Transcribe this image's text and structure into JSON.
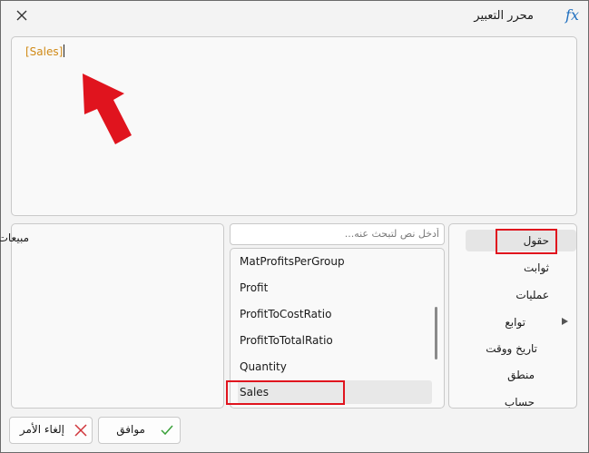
{
  "dialog": {
    "title": "محرر التعبير",
    "fx_label": "fx"
  },
  "editor": {
    "expression": "[Sales]"
  },
  "description": {
    "text": "مبيعات"
  },
  "search": {
    "placeholder": "أدخل نص لتبحث عنه..."
  },
  "fields": {
    "items": [
      {
        "label": "MatProfitsPerGroup"
      },
      {
        "label": "Profit"
      },
      {
        "label": "ProfitToCostRatio"
      },
      {
        "label": "ProfitToTotalRatio"
      },
      {
        "label": "Quantity"
      },
      {
        "label": "Sales"
      }
    ],
    "selected": "Sales"
  },
  "categories": {
    "items": [
      {
        "label": "حقول"
      },
      {
        "label": "ثوابت"
      },
      {
        "label": "عمليات"
      },
      {
        "label": "توابع"
      },
      {
        "label": "تاريخ ووقت"
      },
      {
        "label": "منطق"
      },
      {
        "label": "حساب"
      }
    ],
    "selected": "حقول"
  },
  "buttons": {
    "ok_label": "موافق",
    "cancel_label": "إلغاء الأمر"
  },
  "colors": {
    "expression_field": "#d08a17",
    "highlight_box": "#e0141e",
    "arrow": "#e0141e",
    "fx_icon": "#1f6fbf",
    "ok_icon": "#3aa13a",
    "cancel_icon": "#d0343a"
  },
  "icons": {
    "close": "close-icon",
    "fx": "fx-icon",
    "ok": "checkmark-icon",
    "cancel": "cross-icon",
    "expand": "triangle-right-icon",
    "annotation": "arrow-up-icon"
  }
}
